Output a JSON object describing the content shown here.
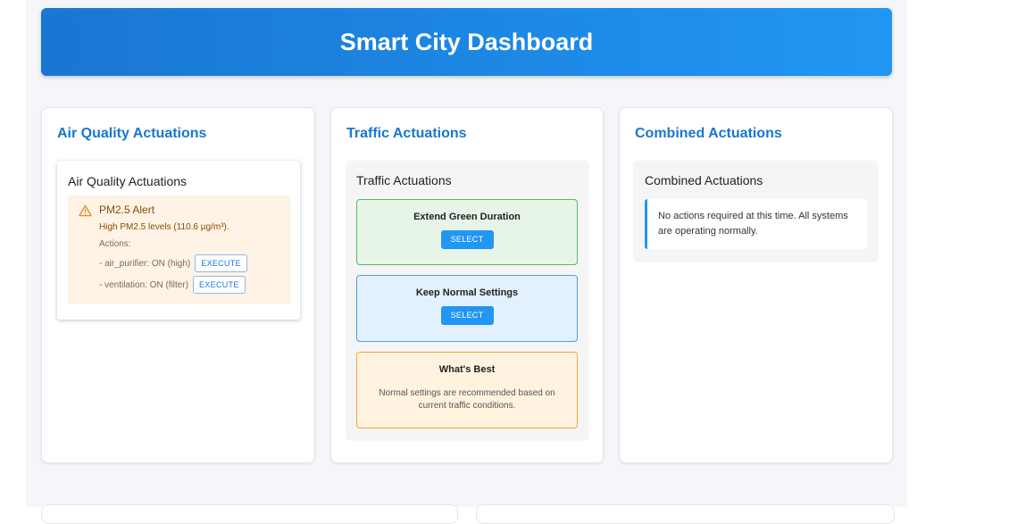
{
  "header": {
    "title": "Smart City Dashboard"
  },
  "air_quality": {
    "card_title": "Air Quality Actuations",
    "panel_title": "Air Quality Actuations",
    "alert": {
      "icon": "warning-triangle-icon",
      "title": "PM2.5 Alert",
      "description": "High PM2.5 levels (110.6 µg/m³).",
      "actions_label": "Actions:",
      "actions": [
        {
          "text": "- air_purifier: ON (high)",
          "button": "EXECUTE"
        },
        {
          "text": "- ventilation: ON (filter)",
          "button": "EXECUTE"
        }
      ]
    }
  },
  "traffic": {
    "card_title": "Traffic Actuations",
    "panel_title": "Traffic Actuations",
    "options": [
      {
        "title": "Extend Green Duration",
        "button": "SELECT"
      },
      {
        "title": "Keep Normal Settings",
        "button": "SELECT"
      }
    ],
    "best": {
      "title": "What's Best",
      "description": "Normal settings are recommended based on current traffic conditions."
    }
  },
  "combined": {
    "card_title": "Combined Actuations",
    "panel_title": "Combined Actuations",
    "message": "No actions required at this time. All systems are operating normally."
  },
  "colors": {
    "header_gradient_start": "#1976d2",
    "header_gradient_end": "#2196f3",
    "accent": "#1976d2",
    "alert_bg": "#fff3e5",
    "option_green": "#e7f5e8",
    "option_blue": "#e3f0fd",
    "option_orange": "#fff3e0"
  }
}
